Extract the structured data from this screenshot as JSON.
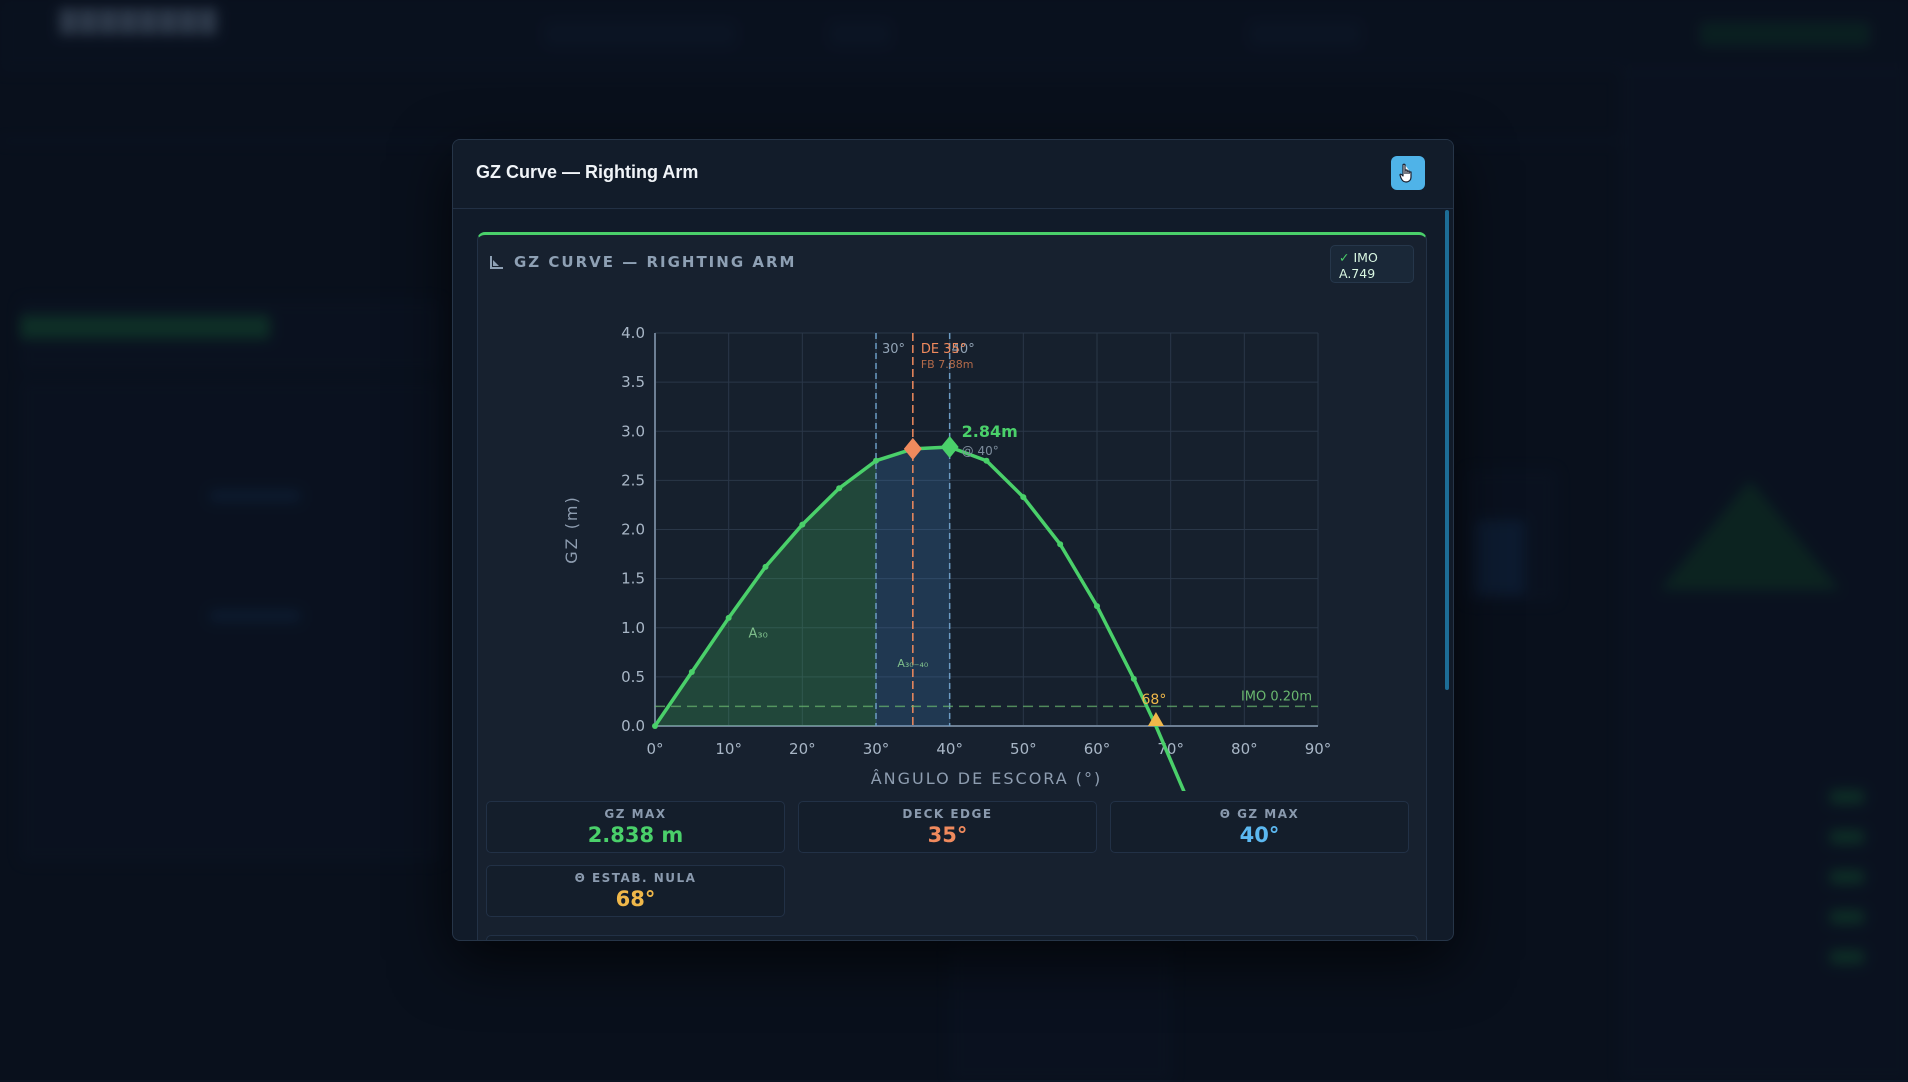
{
  "modal": {
    "title": "GZ Curve — Righting Arm"
  },
  "card": {
    "title": "GZ CURVE — RIGHTING ARM",
    "badge_line1": "IMO",
    "badge_line2": "A.749",
    "badge_check": "✓"
  },
  "chart_data": {
    "type": "line",
    "xlabel": "ÂNGULO DE ESCORA (°)",
    "ylabel": "GZ (m)",
    "xlim": [
      0,
      90
    ],
    "ylim": [
      0,
      4.0
    ],
    "x_ticks": [
      "0°",
      "10°",
      "20°",
      "30°",
      "40°",
      "50°",
      "60°",
      "70°",
      "80°",
      "90°"
    ],
    "y_ticks": [
      "0.0",
      "0.5",
      "1.0",
      "1.5",
      "2.0",
      "2.5",
      "3.0",
      "3.5",
      "4.0"
    ],
    "grid": true,
    "series": [
      {
        "x": [
          0,
          5,
          10,
          15,
          20,
          25,
          30,
          35,
          40,
          45,
          50,
          55,
          60,
          65,
          68,
          72
        ],
        "y": [
          0.0,
          0.55,
          1.1,
          1.62,
          2.05,
          2.42,
          2.7,
          2.82,
          2.84,
          2.7,
          2.33,
          1.85,
          1.22,
          0.48,
          0.0,
          -0.7
        ]
      }
    ],
    "annotations": {
      "max_label": "2.84m",
      "max_sub": "@ 40°",
      "vline_30_label": "30°",
      "vline_40_label": "40°",
      "deck_edge_label": "DE 35°",
      "freeboard_label": "FB 7.88m",
      "area_30_label": "A₃₀",
      "area_30_40_label": "A₃₀₋₄₀",
      "vanish_label": "68°",
      "imo_line_label": "IMO 0.20m",
      "imo_line_value": 0.2,
      "deck_edge_angle": 35,
      "gz_max_angle": 40,
      "vanish_angle": 68
    }
  },
  "stats": [
    {
      "label": "GZ MAX",
      "value": "2.838 m",
      "color": "#4ad06a"
    },
    {
      "label": "DECK EDGE",
      "value": "35°",
      "color": "#f08a5d"
    },
    {
      "label": "Θ GZ MAX",
      "value": "40°",
      "color": "#5cb8f0"
    },
    {
      "label": "Θ ESTAB. NULA",
      "value": "68°",
      "color": "#f0b84a"
    }
  ],
  "colors": {
    "curve": "#4ad06a",
    "deck_edge": "#f08a5d",
    "imo": "#6ab86f",
    "vanish": "#f0b84a"
  }
}
